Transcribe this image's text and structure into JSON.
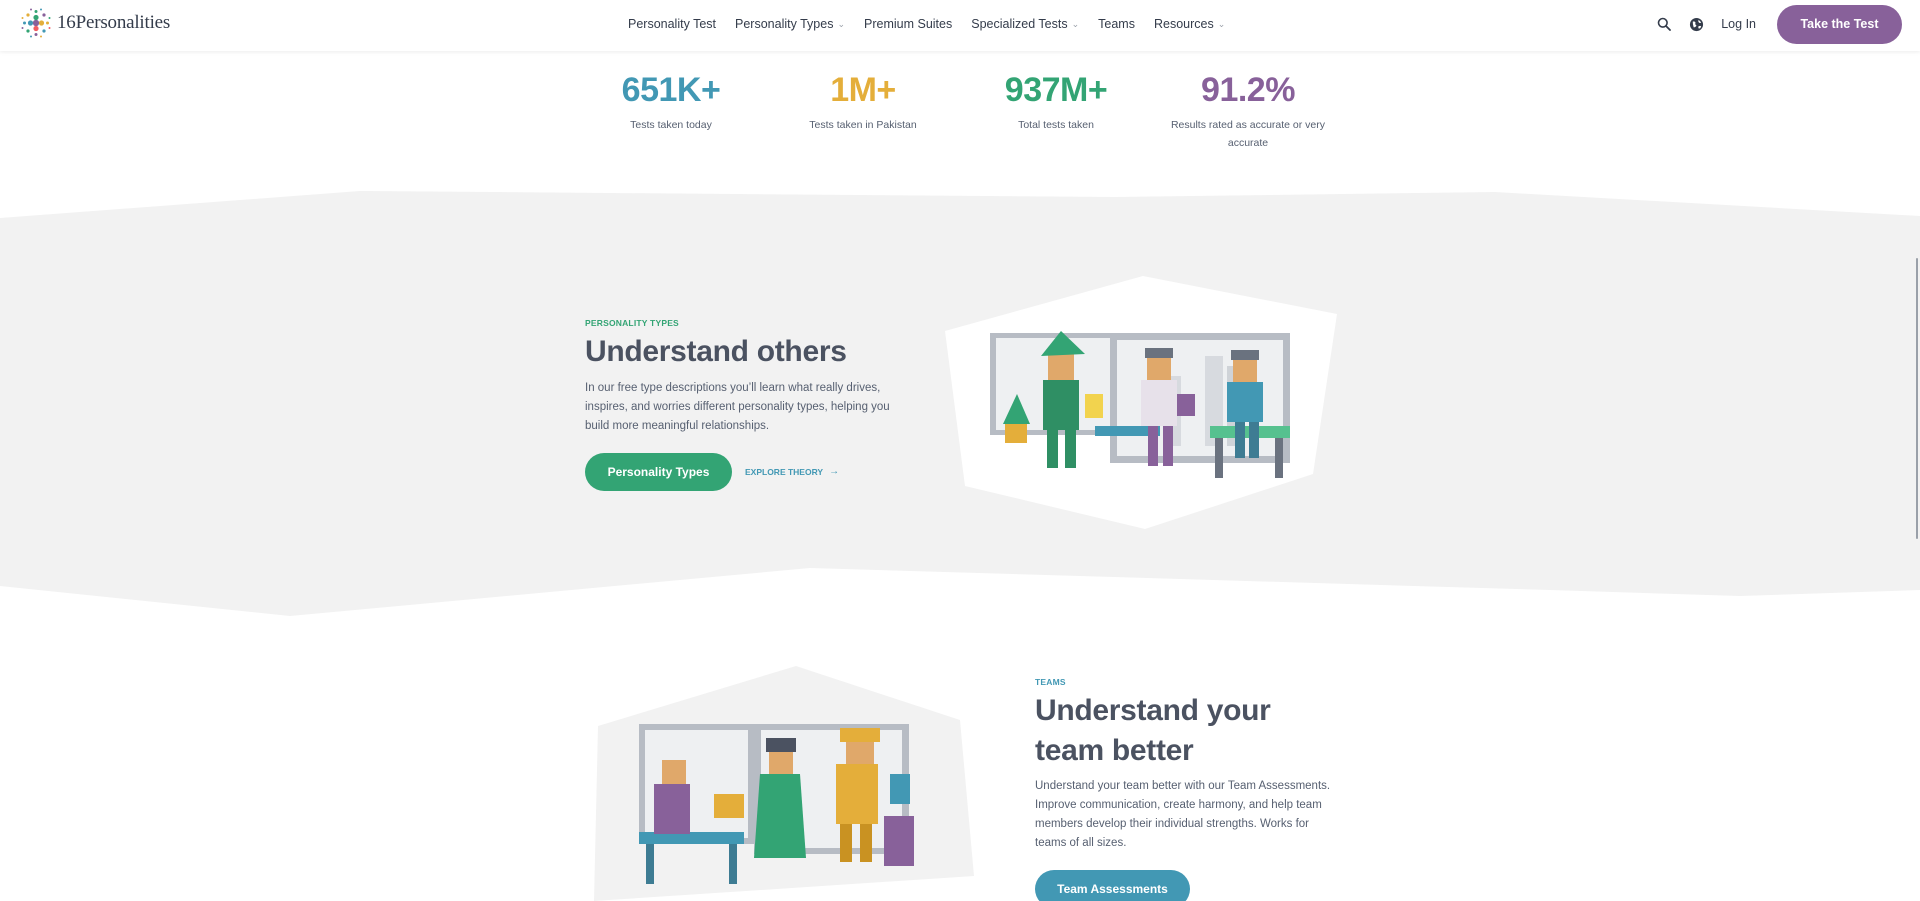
{
  "header": {
    "logo_text": "16Personalities",
    "nav": [
      {
        "label": "Personality Test",
        "dropdown": false
      },
      {
        "label": "Personality Types",
        "dropdown": true
      },
      {
        "label": "Premium Suites",
        "dropdown": false
      },
      {
        "label": "Specialized Tests",
        "dropdown": true
      },
      {
        "label": "Teams",
        "dropdown": false
      },
      {
        "label": "Resources",
        "dropdown": true
      }
    ],
    "login_label": "Log In",
    "cta_label": "Take the Test",
    "icons": [
      "search-icon",
      "globe-icon"
    ]
  },
  "stats": [
    {
      "value": "651K+",
      "label": "Tests taken today",
      "color": "#4298b4"
    },
    {
      "value": "1M+",
      "label": "Tests taken in Pakistan",
      "color": "#e4ae3a"
    },
    {
      "value": "937M+",
      "label": "Total tests taken",
      "color": "#33a474"
    },
    {
      "value": "91.2%",
      "label": "Results rated as accurate or very accurate",
      "color": "#88619a"
    }
  ],
  "section_types": {
    "eyebrow": "Personality Types",
    "title": "Understand others",
    "body": "In our free type descriptions you’ll learn what really drives, inspires, and worries different personality types, helping you build more meaningful relationships.",
    "button_label": "Personality Types",
    "link_label": "Explore Theory",
    "accent": "#33a474"
  },
  "section_teams": {
    "eyebrow": "Teams",
    "title_line1": "Understand your",
    "title_line2": "team better",
    "body": "Understand your team better with our Team Assessments. Improve communication, create harmony, and help team members develop their individual strengths. Works for teams of all sizes.",
    "button_label": "Team Assessments",
    "accent": "#4298b4"
  },
  "colors": {
    "band_background": "#f2f2f2",
    "cta_purple": "#88619a"
  }
}
